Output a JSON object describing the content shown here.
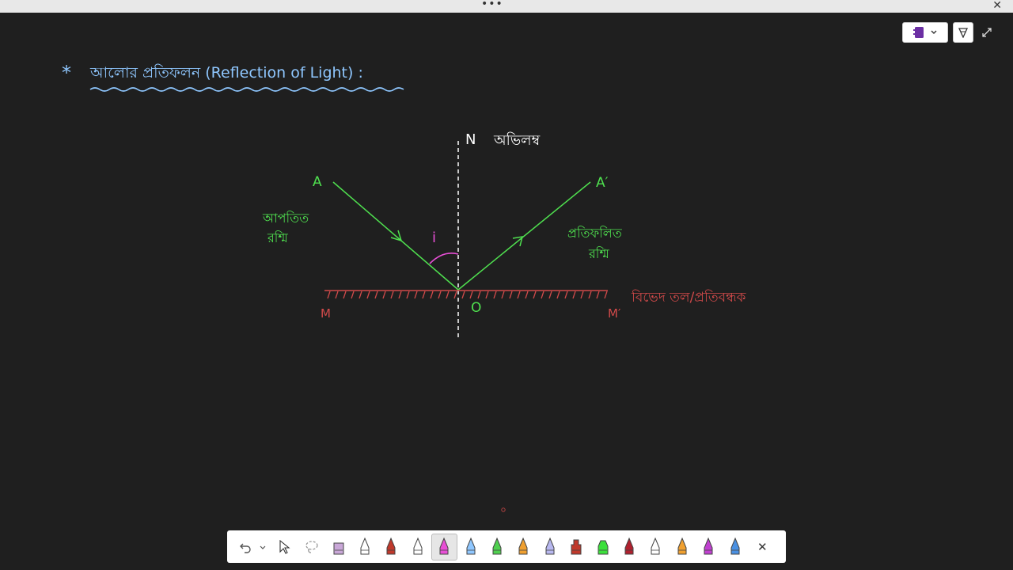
{
  "window": {
    "menu_label": "•••",
    "close_label": "✕"
  },
  "top_tools": {
    "notebook_icon": "notebook-icon",
    "dropdown_icon": "chevron-down-icon",
    "lasso_icon": "lasso-select-icon",
    "expand_icon": "expand-icon"
  },
  "note": {
    "bullet": "*",
    "heading": "আলোর প্রতিফলন (Reflection of Light) :",
    "diagram": {
      "normal_letter": "N",
      "normal_label": "অভিলম্ব",
      "point_a": "A",
      "point_a_prime": "A′",
      "incident_label_line1": "আপতিত",
      "incident_label_line2": "রশ্মি",
      "reflected_label_line1": "প্রতিফলিত",
      "reflected_label_line2": "রশ্মি",
      "angle_label": "i",
      "point_o": "O",
      "point_m": "M",
      "point_m_prime": "M′",
      "surface_label": "বিভেদ তল/প্রতিবন্ধক"
    },
    "colors": {
      "heading": "#8fc7ff",
      "ray": "#4fe04f",
      "surface": "#d14a4a",
      "angle": "#e84fd6",
      "normal": "#ffffff"
    }
  },
  "toolbar": {
    "undo_icon": "undo-icon",
    "undo_dropdown_icon": "chevron-down-icon",
    "select_icon": "select-cursor-icon",
    "lasso_icon": "lasso-icon",
    "close_label": "✕",
    "pens": [
      {
        "name": "eraser-tool",
        "color": "#c9a7d8"
      },
      {
        "name": "pencil-tool",
        "color": "#ffffff"
      },
      {
        "name": "pen-red",
        "color": "#c0392b"
      },
      {
        "name": "pen-white",
        "color": "#ffffff"
      },
      {
        "name": "pen-pink",
        "color": "#e84fd6"
      },
      {
        "name": "pen-lightblue",
        "color": "#8fc7ff"
      },
      {
        "name": "pen-green",
        "color": "#4fd04f"
      },
      {
        "name": "pen-orange",
        "color": "#f0a030"
      },
      {
        "name": "pen-lavender",
        "color": "#b8b8f0"
      },
      {
        "name": "ruler-tool",
        "color": "#c0392b"
      },
      {
        "name": "highlighter-green",
        "color": "#3ce03c"
      },
      {
        "name": "pen-darkred",
        "color": "#b0202e"
      },
      {
        "name": "pen-white-2",
        "color": "#ffffff"
      },
      {
        "name": "pen-orange-2",
        "color": "#f0a030"
      },
      {
        "name": "pen-purple",
        "color": "#c040d0"
      },
      {
        "name": "pen-blue",
        "color": "#4a90e2"
      }
    ]
  }
}
